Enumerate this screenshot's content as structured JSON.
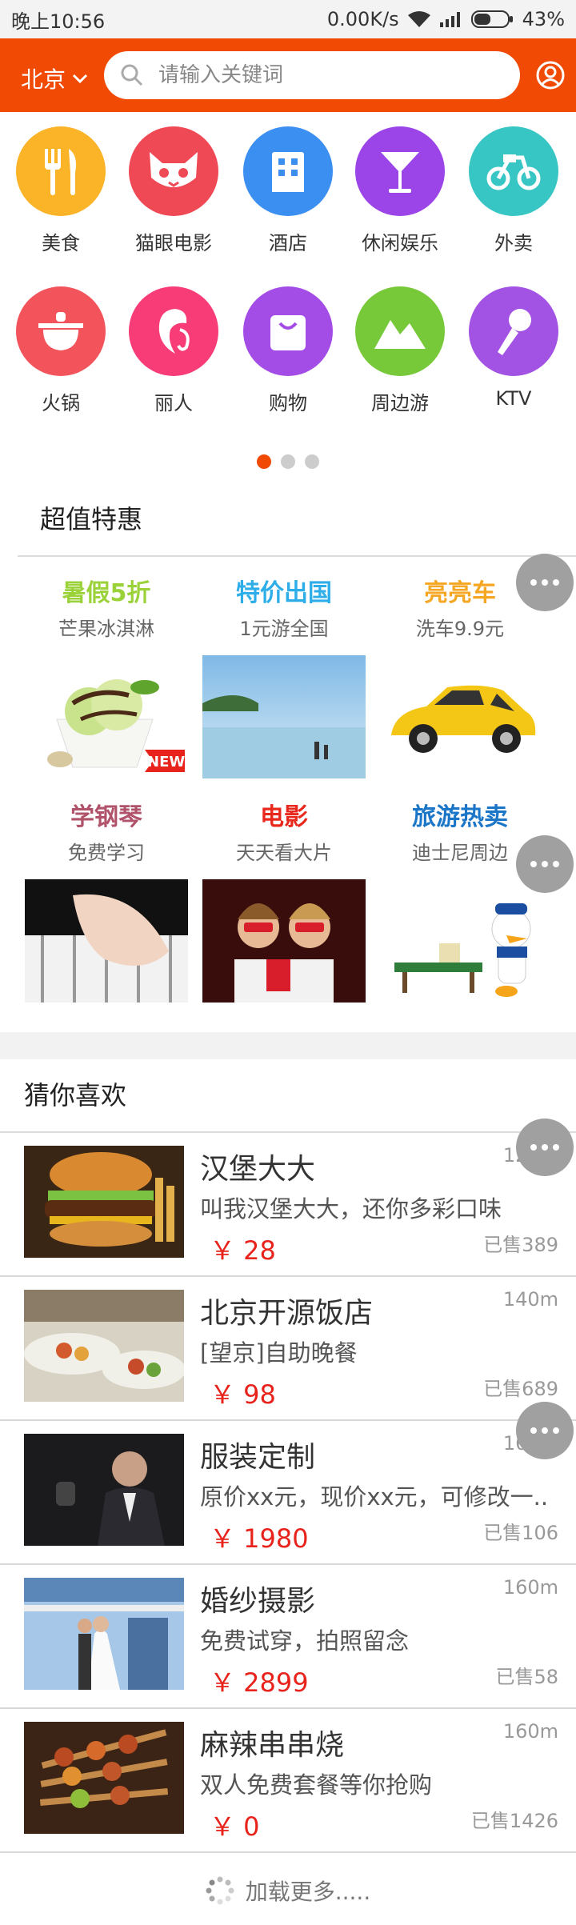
{
  "status_bar": {
    "time": "晚上10:56",
    "speed": "0.00K/s",
    "battery": "43%"
  },
  "header": {
    "city": "北京",
    "search_placeholder": "请输入关键词"
  },
  "categories": [
    {
      "label": "美食",
      "icon": "food-icon",
      "color": "#fbb327"
    },
    {
      "label": "猫眼电影",
      "icon": "cat-icon",
      "color": "#f04956"
    },
    {
      "label": "酒店",
      "icon": "hotel-icon",
      "color": "#3a8ff0"
    },
    {
      "label": "休闲娱乐",
      "icon": "cocktail-icon",
      "color": "#9b45e9"
    },
    {
      "label": "外卖",
      "icon": "takeout-icon",
      "color": "#37c6c3"
    },
    {
      "label": "火锅",
      "icon": "hotpot-icon",
      "color": "#f3535b"
    },
    {
      "label": "丽人",
      "icon": "beauty-icon",
      "color": "#f73c78"
    },
    {
      "label": "购物",
      "icon": "shopping-icon",
      "color": "#a44de6"
    },
    {
      "label": "周边游",
      "icon": "mountain-icon",
      "color": "#77c93a"
    },
    {
      "label": "KTV",
      "icon": "microphone-icon",
      "color": "#a353e4"
    }
  ],
  "deals_section": {
    "title": "超值特惠"
  },
  "deals": [
    {
      "title": "暑假5折",
      "sub": "芒果冰淇淋",
      "color": "#9bd23a",
      "badge": "NEW"
    },
    {
      "title": "特价出国",
      "sub": "1元游全国",
      "color": "#2daee8"
    },
    {
      "title": "亮亮车",
      "sub": "洗车9.9元",
      "color": "#f5a623"
    },
    {
      "title": "学钢琴",
      "sub": "免费学习",
      "color": "#b0536a"
    },
    {
      "title": "电影",
      "sub": "天天看大片",
      "color": "#e8281d"
    },
    {
      "title": "旅游热卖",
      "sub": "迪士尼周边",
      "color": "#1b76c8"
    }
  ],
  "guess_section": {
    "title": "猜你喜欢"
  },
  "items": [
    {
      "title": "汉堡大大",
      "desc": "叫我汉堡大大，还你多彩口味",
      "price": "￥ 28",
      "distance": "120m",
      "sold": "已售389"
    },
    {
      "title": "北京开源饭店",
      "desc": "[望京]自助晚餐",
      "price": "￥ 98",
      "distance": "140m",
      "sold": "已售689"
    },
    {
      "title": "服装定制",
      "desc": "原价xx元，现价xx元，可修改一..",
      "price": "￥ 1980",
      "distance": "160m",
      "sold": "已售106"
    },
    {
      "title": "婚纱摄影",
      "desc": "免费试穿，拍照留念",
      "price": "￥ 2899",
      "distance": "160m",
      "sold": "已售58"
    },
    {
      "title": "麻辣串串烧",
      "desc": "双人免费套餐等你抢购",
      "price": "￥ 0",
      "distance": "160m",
      "sold": "已售1426"
    }
  ],
  "load_more": "加载更多....."
}
